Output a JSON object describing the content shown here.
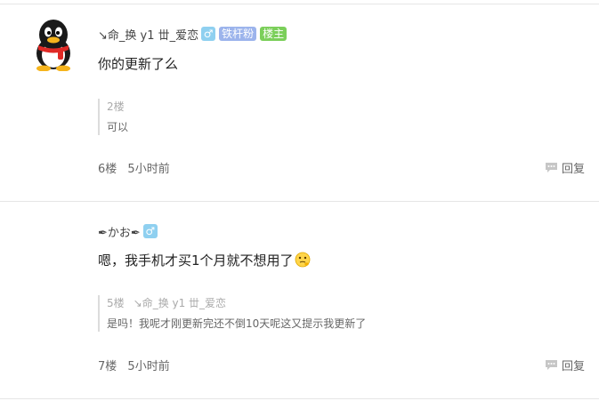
{
  "posts": [
    {
      "username": "↘命_换 y1 丗_爱恋",
      "gender_symbol": "♂",
      "badges": [
        "铁杆粉",
        "楼主"
      ],
      "content": "你的更新了么",
      "quote": {
        "floor": "2楼",
        "username": "",
        "text": "可以"
      },
      "floor": "6楼",
      "time": "5小时前",
      "reply_label": "回复"
    },
    {
      "username": "✒かお✒",
      "gender_symbol": "♂",
      "content": "嗯，我手机才买1个月就不想用了",
      "emoji": "thinking-face-icon",
      "quote": {
        "floor": "5楼",
        "username": "↘命_换 y1 丗_爱恋",
        "text": "是吗！我呢才刚更新完还不倒10天呢这又提示我更新了"
      },
      "floor": "7楼",
      "time": "5小时前",
      "reply_label": "回复"
    }
  ],
  "colors": {
    "gender_badge": "#8fd0f0",
    "fan_badge": "#9cb4ec",
    "host_badge": "#7bcf5a",
    "divider": "#e6e6e6"
  }
}
